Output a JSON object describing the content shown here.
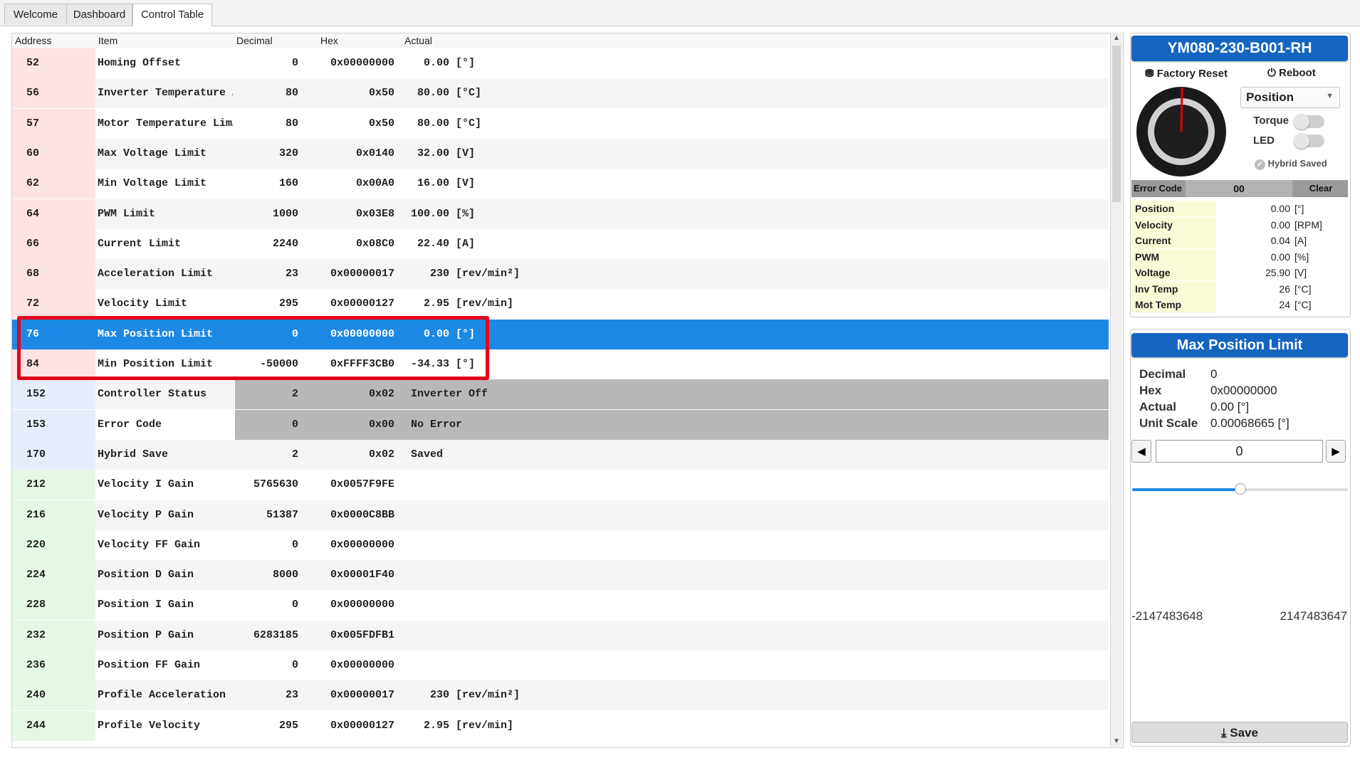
{
  "tabs": [
    {
      "label": "Welcome"
    },
    {
      "label": "Dashboard"
    },
    {
      "label": "Control Table",
      "active": true
    }
  ],
  "table": {
    "headers": {
      "address": "Address",
      "item": "Item",
      "decimal": "Decimal",
      "hex": "Hex",
      "actual": "Actual"
    },
    "rows": [
      {
        "address": "52",
        "item": "Homing Offset",
        "decimal": "0",
        "hex": "0x00000000",
        "actual": "  0.00 [°]",
        "group": "red"
      },
      {
        "address": "56",
        "item": "Inverter Temperature …",
        "decimal": "80",
        "hex": "0x50",
        "actual": " 80.00 [°C]",
        "group": "red"
      },
      {
        "address": "57",
        "item": "Motor Temperature Lim…",
        "decimal": "80",
        "hex": "0x50",
        "actual": " 80.00 [°C]",
        "group": "red"
      },
      {
        "address": "60",
        "item": "Max Voltage Limit",
        "decimal": "320",
        "hex": "0x0140",
        "actual": " 32.00 [V]",
        "group": "red"
      },
      {
        "address": "62",
        "item": "Min Voltage Limit",
        "decimal": "160",
        "hex": "0x00A0",
        "actual": " 16.00 [V]",
        "group": "red"
      },
      {
        "address": "64",
        "item": "PWM Limit",
        "decimal": "1000",
        "hex": "0x03E8",
        "actual": "100.00 [%]",
        "group": "red"
      },
      {
        "address": "66",
        "item": "Current Limit",
        "decimal": "2240",
        "hex": "0x08C0",
        "actual": " 22.40 [A]",
        "group": "red"
      },
      {
        "address": "68",
        "item": "Acceleration Limit",
        "decimal": "23",
        "hex": "0x00000017",
        "actual": "   230 [rev/min²]",
        "group": "red"
      },
      {
        "address": "72",
        "item": "Velocity Limit",
        "decimal": "295",
        "hex": "0x00000127",
        "actual": "  2.95 [rev/min]",
        "group": "red"
      },
      {
        "address": "76",
        "item": "Max Position Limit",
        "decimal": "0",
        "hex": "0x00000000",
        "actual": "  0.00 [°]",
        "group": "red",
        "selected": true
      },
      {
        "address": "84",
        "item": "Min Position Limit",
        "decimal": "-50000",
        "hex": "0xFFFF3CB0",
        "actual": "-34.33 [°]",
        "group": "red"
      },
      {
        "address": "152",
        "item": "Controller Status",
        "decimal": "2",
        "hex": "0x02",
        "actual": "Inverter Off",
        "group": "blue",
        "readonly": true
      },
      {
        "address": "153",
        "item": "Error Code",
        "decimal": "0",
        "hex": "0x00",
        "actual": "No Error",
        "group": "blue",
        "readonly": true
      },
      {
        "address": "170",
        "item": "Hybrid Save",
        "decimal": "2",
        "hex": "0x02",
        "actual": "Saved",
        "group": "blue"
      },
      {
        "address": "212",
        "item": "Velocity I Gain",
        "decimal": "5765630",
        "hex": "0x0057F9FE",
        "actual": "",
        "group": "green"
      },
      {
        "address": "216",
        "item": "Velocity P Gain",
        "decimal": "51387",
        "hex": "0x0000C8BB",
        "actual": "",
        "group": "green"
      },
      {
        "address": "220",
        "item": "Velocity FF Gain",
        "decimal": "0",
        "hex": "0x00000000",
        "actual": "",
        "group": "green"
      },
      {
        "address": "224",
        "item": "Position D Gain",
        "decimal": "8000",
        "hex": "0x00001F40",
        "actual": "",
        "group": "green"
      },
      {
        "address": "228",
        "item": "Position I Gain",
        "decimal": "0",
        "hex": "0x00000000",
        "actual": "",
        "group": "green"
      },
      {
        "address": "232",
        "item": "Position P Gain",
        "decimal": "6283185",
        "hex": "0x005FDFB1",
        "actual": "",
        "group": "green"
      },
      {
        "address": "236",
        "item": "Position FF Gain",
        "decimal": "0",
        "hex": "0x00000000",
        "actual": "",
        "group": "green"
      },
      {
        "address": "240",
        "item": "Profile Acceleration",
        "decimal": "23",
        "hex": "0x00000017",
        "actual": "   230 [rev/min²]",
        "group": "green"
      },
      {
        "address": "244",
        "item": "Profile Velocity",
        "decimal": "295",
        "hex": "0x00000127",
        "actual": "  2.95 [rev/min]",
        "group": "green"
      }
    ],
    "group_colors": {
      "red": "#fde3e3",
      "blue": "#e6edfb",
      "green": "#e6f7e6"
    }
  },
  "device": {
    "model": "YM080-230-B001-RH",
    "factory_reset_label": "Factory Reset",
    "reboot_label": "Reboot",
    "mode_value": "Position",
    "torque_label": "Torque",
    "led_label": "LED",
    "torque_on": false,
    "led_on": false,
    "hybrid_saved_label": "Hybrid Saved",
    "error_code_label": "Error Code",
    "error_code_value": "00",
    "clear_label": "Clear",
    "status": [
      {
        "label": "Position",
        "value": "0.00",
        "unit": "[°]"
      },
      {
        "label": "Velocity",
        "value": "0.00",
        "unit": "[RPM]"
      },
      {
        "label": "Current",
        "value": "0.04",
        "unit": "[A]"
      },
      {
        "label": "PWM",
        "value": "0.00",
        "unit": "[%]"
      },
      {
        "label": "Voltage",
        "value": "25.90",
        "unit": "[V]"
      },
      {
        "label": "Inv Temp",
        "value": "26",
        "unit": "[°C]"
      },
      {
        "label": "Mot Temp",
        "value": "24",
        "unit": "[°C]"
      }
    ],
    "accent": "#1565c0"
  },
  "editor": {
    "title": "Max Position Limit",
    "fields": [
      {
        "label": "Decimal",
        "value": "0"
      },
      {
        "label": "Hex",
        "value": "0x00000000"
      },
      {
        "label": "Actual",
        "value": "0.00 [°]"
      },
      {
        "label": "Unit Scale",
        "value": "0.00068665 [°]"
      }
    ],
    "input_value": "0",
    "slider_fraction": 0.5,
    "range_min": "-2147483648",
    "range_max": "2147483647",
    "save_label": "Save"
  }
}
